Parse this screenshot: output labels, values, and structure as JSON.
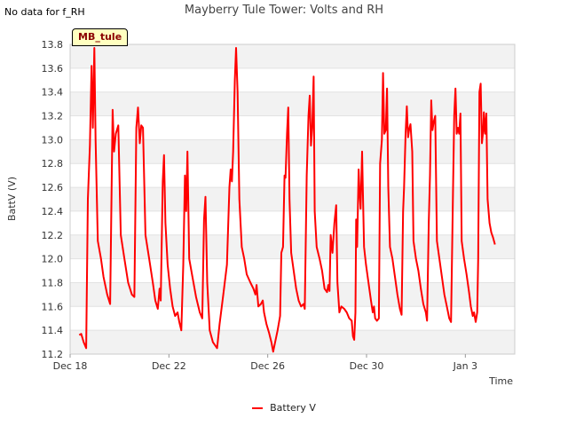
{
  "header": {
    "note": "No data for f_RH",
    "title": "Mayberry Tule Tower: Volts and RH"
  },
  "station_label": "MB_tule",
  "chart_data": {
    "type": "line",
    "title": "Mayberry Tule Tower: Volts and RH",
    "xlabel": "Time",
    "ylabel": "BattV (V)",
    "ylim": [
      11.2,
      13.8
    ],
    "xlim": [
      0,
      18
    ],
    "x_unit": "days from Dec 18",
    "x_ticks": [
      {
        "x": 0,
        "label": "Dec 18"
      },
      {
        "x": 4,
        "label": "Dec 22"
      },
      {
        "x": 8,
        "label": "Dec 26"
      },
      {
        "x": 12,
        "label": "Dec 30"
      },
      {
        "x": 16,
        "label": "Jan 3"
      }
    ],
    "y_ticks": [
      "11.2",
      "11.4",
      "11.6",
      "11.8",
      "12.0",
      "12.2",
      "12.4",
      "12.6",
      "12.8",
      "13.0",
      "13.2",
      "13.4",
      "13.6",
      "13.8"
    ],
    "grid": true,
    "legend_position": "bottom",
    "series": [
      {
        "name": "Battery V",
        "color": "#ff0000",
        "points": [
          [
            0.37,
            11.36
          ],
          [
            0.45,
            11.37
          ],
          [
            0.55,
            11.3
          ],
          [
            0.65,
            11.25
          ],
          [
            0.72,
            12.5
          ],
          [
            0.8,
            12.95
          ],
          [
            0.87,
            13.62
          ],
          [
            0.92,
            13.1
          ],
          [
            0.98,
            13.77
          ],
          [
            1.03,
            13.0
          ],
          [
            1.12,
            12.15
          ],
          [
            1.25,
            12.0
          ],
          [
            1.35,
            11.85
          ],
          [
            1.5,
            11.7
          ],
          [
            1.62,
            11.62
          ],
          [
            1.72,
            13.25
          ],
          [
            1.78,
            12.9
          ],
          [
            1.85,
            13.05
          ],
          [
            1.95,
            13.12
          ],
          [
            2.05,
            12.2
          ],
          [
            2.2,
            12.0
          ],
          [
            2.35,
            11.8
          ],
          [
            2.5,
            11.7
          ],
          [
            2.6,
            11.68
          ],
          [
            2.68,
            13.1
          ],
          [
            2.75,
            13.27
          ],
          [
            2.82,
            12.97
          ],
          [
            2.88,
            13.12
          ],
          [
            2.95,
            13.1
          ],
          [
            3.05,
            12.2
          ],
          [
            3.2,
            12.0
          ],
          [
            3.35,
            11.8
          ],
          [
            3.45,
            11.65
          ],
          [
            3.55,
            11.58
          ],
          [
            3.62,
            11.75
          ],
          [
            3.67,
            11.65
          ],
          [
            3.75,
            12.65
          ],
          [
            3.8,
            12.87
          ],
          [
            3.86,
            12.3
          ],
          [
            3.95,
            11.95
          ],
          [
            4.05,
            11.75
          ],
          [
            4.15,
            11.6
          ],
          [
            4.25,
            11.52
          ],
          [
            4.35,
            11.55
          ],
          [
            4.42,
            11.47
          ],
          [
            4.5,
            11.4
          ],
          [
            4.58,
            11.95
          ],
          [
            4.65,
            12.7
          ],
          [
            4.7,
            12.4
          ],
          [
            4.75,
            12.9
          ],
          [
            4.82,
            12.0
          ],
          [
            4.95,
            11.85
          ],
          [
            5.1,
            11.68
          ],
          [
            5.25,
            11.55
          ],
          [
            5.35,
            11.5
          ],
          [
            5.42,
            12.33
          ],
          [
            5.48,
            12.52
          ],
          [
            5.55,
            11.8
          ],
          [
            5.65,
            11.4
          ],
          [
            5.78,
            11.3
          ],
          [
            5.88,
            11.27
          ],
          [
            5.95,
            11.25
          ],
          [
            6.05,
            11.45
          ],
          [
            6.2,
            11.7
          ],
          [
            6.35,
            11.95
          ],
          [
            6.45,
            12.6
          ],
          [
            6.5,
            12.75
          ],
          [
            6.55,
            12.65
          ],
          [
            6.6,
            12.9
          ],
          [
            6.67,
            13.5
          ],
          [
            6.72,
            13.77
          ],
          [
            6.78,
            13.4
          ],
          [
            6.85,
            12.5
          ],
          [
            6.95,
            12.1
          ],
          [
            7.05,
            12.0
          ],
          [
            7.15,
            11.87
          ],
          [
            7.3,
            11.8
          ],
          [
            7.42,
            11.75
          ],
          [
            7.5,
            11.7
          ],
          [
            7.55,
            11.78
          ],
          [
            7.62,
            11.6
          ],
          [
            7.72,
            11.62
          ],
          [
            7.8,
            11.65
          ],
          [
            7.85,
            11.55
          ],
          [
            7.95,
            11.45
          ],
          [
            8.05,
            11.38
          ],
          [
            8.15,
            11.3
          ],
          [
            8.22,
            11.22
          ],
          [
            8.3,
            11.3
          ],
          [
            8.4,
            11.4
          ],
          [
            8.5,
            11.52
          ],
          [
            8.55,
            12.05
          ],
          [
            8.62,
            12.1
          ],
          [
            8.68,
            12.7
          ],
          [
            8.72,
            12.68
          ],
          [
            8.78,
            13.05
          ],
          [
            8.83,
            13.27
          ],
          [
            8.88,
            12.5
          ],
          [
            8.95,
            12.05
          ],
          [
            9.05,
            11.9
          ],
          [
            9.15,
            11.75
          ],
          [
            9.25,
            11.65
          ],
          [
            9.35,
            11.6
          ],
          [
            9.45,
            11.62
          ],
          [
            9.5,
            11.58
          ],
          [
            9.58,
            12.7
          ],
          [
            9.65,
            13.2
          ],
          [
            9.7,
            13.37
          ],
          [
            9.75,
            12.95
          ],
          [
            9.8,
            13.1
          ],
          [
            9.86,
            13.53
          ],
          [
            9.9,
            12.4
          ],
          [
            9.98,
            12.1
          ],
          [
            10.1,
            12.0
          ],
          [
            10.2,
            11.9
          ],
          [
            10.3,
            11.75
          ],
          [
            10.4,
            11.72
          ],
          [
            10.45,
            11.78
          ],
          [
            10.5,
            11.73
          ],
          [
            10.55,
            12.2
          ],
          [
            10.62,
            12.05
          ],
          [
            10.7,
            12.3
          ],
          [
            10.77,
            12.45
          ],
          [
            10.82,
            11.8
          ],
          [
            10.9,
            11.55
          ],
          [
            10.98,
            11.6
          ],
          [
            11.1,
            11.58
          ],
          [
            11.2,
            11.55
          ],
          [
            11.3,
            11.5
          ],
          [
            11.4,
            11.48
          ],
          [
            11.45,
            11.35
          ],
          [
            11.5,
            11.32
          ],
          [
            11.55,
            11.55
          ],
          [
            11.58,
            12.33
          ],
          [
            11.62,
            12.1
          ],
          [
            11.68,
            12.75
          ],
          [
            11.72,
            12.55
          ],
          [
            11.76,
            12.42
          ],
          [
            11.82,
            12.9
          ],
          [
            11.85,
            12.6
          ],
          [
            11.9,
            12.1
          ],
          [
            11.98,
            11.95
          ],
          [
            12.08,
            11.8
          ],
          [
            12.18,
            11.65
          ],
          [
            12.25,
            11.55
          ],
          [
            12.3,
            11.6
          ],
          [
            12.35,
            11.5
          ],
          [
            12.42,
            11.48
          ],
          [
            12.5,
            11.5
          ],
          [
            12.55,
            12.8
          ],
          [
            12.62,
            13.0
          ],
          [
            12.67,
            13.56
          ],
          [
            12.72,
            13.05
          ],
          [
            12.78,
            13.08
          ],
          [
            12.83,
            13.43
          ],
          [
            12.88,
            12.6
          ],
          [
            12.95,
            12.1
          ],
          [
            13.05,
            12.0
          ],
          [
            13.15,
            11.85
          ],
          [
            13.25,
            11.7
          ],
          [
            13.35,
            11.58
          ],
          [
            13.42,
            11.53
          ],
          [
            13.48,
            12.4
          ],
          [
            13.52,
            12.6
          ],
          [
            13.58,
            13.05
          ],
          [
            13.63,
            13.28
          ],
          [
            13.68,
            13.02
          ],
          [
            13.72,
            13.08
          ],
          [
            13.78,
            13.13
          ],
          [
            13.85,
            12.9
          ],
          [
            13.9,
            12.15
          ],
          [
            14.0,
            12.0
          ],
          [
            14.1,
            11.9
          ],
          [
            14.2,
            11.75
          ],
          [
            14.3,
            11.62
          ],
          [
            14.4,
            11.55
          ],
          [
            14.45,
            11.48
          ],
          [
            14.52,
            12.3
          ],
          [
            14.57,
            12.7
          ],
          [
            14.62,
            13.33
          ],
          [
            14.67,
            13.08
          ],
          [
            14.72,
            13.15
          ],
          [
            14.78,
            13.2
          ],
          [
            14.85,
            12.15
          ],
          [
            14.95,
            12.0
          ],
          [
            15.05,
            11.85
          ],
          [
            15.15,
            11.7
          ],
          [
            15.25,
            11.6
          ],
          [
            15.35,
            11.5
          ],
          [
            15.42,
            11.47
          ],
          [
            15.5,
            12.55
          ],
          [
            15.55,
            13.2
          ],
          [
            15.6,
            13.43
          ],
          [
            15.65,
            13.05
          ],
          [
            15.7,
            13.1
          ],
          [
            15.75,
            13.05
          ],
          [
            15.8,
            13.22
          ],
          [
            15.85,
            12.15
          ],
          [
            15.95,
            12.0
          ],
          [
            16.05,
            11.87
          ],
          [
            16.15,
            11.72
          ],
          [
            16.22,
            11.6
          ],
          [
            16.3,
            11.52
          ],
          [
            16.35,
            11.55
          ],
          [
            16.42,
            11.47
          ],
          [
            16.48,
            11.55
          ],
          [
            16.52,
            12.0
          ],
          [
            16.57,
            13.4
          ],
          [
            16.62,
            13.47
          ],
          [
            16.67,
            12.97
          ],
          [
            16.72,
            13.07
          ],
          [
            16.75,
            13.23
          ],
          [
            16.8,
            13.05
          ],
          [
            16.85,
            13.22
          ],
          [
            16.9,
            12.5
          ],
          [
            16.98,
            12.3
          ],
          [
            17.05,
            12.22
          ],
          [
            17.12,
            12.18
          ],
          [
            17.2,
            12.12
          ]
        ]
      }
    ]
  }
}
